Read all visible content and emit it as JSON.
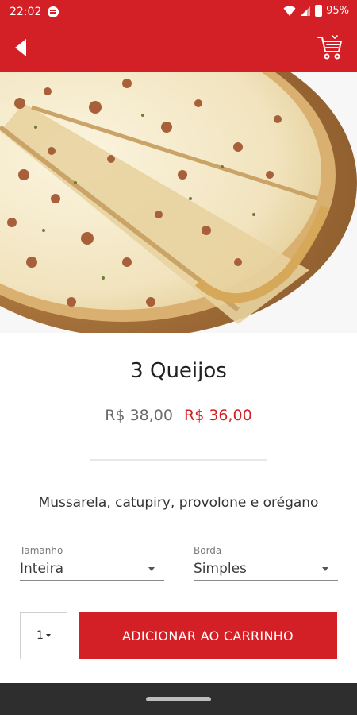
{
  "status_bar": {
    "time": "22:02",
    "battery": "95%",
    "icons": [
      "app-notification-icon",
      "wifi-icon",
      "signal-icon",
      "battery-icon"
    ]
  },
  "app_bar": {
    "background_color": "#d32026",
    "icons": [
      "back-arrow-icon",
      "cart-icon"
    ]
  },
  "product": {
    "image": "pizza-photo",
    "name": "3 Queijos",
    "old_price": "R$ 38,00",
    "price": "R$ 36,00",
    "description": "Mussarela, catupiry, provolone e orégano"
  },
  "options": {
    "size": {
      "label": "Tamanho",
      "value": "Inteira"
    },
    "border": {
      "label": "Borda",
      "value": "Simples"
    }
  },
  "cart_action": {
    "quantity": "1",
    "add_label": "ADICIONAR AO CARRINHO"
  },
  "colors": {
    "accent": "#d32026",
    "nav_bar": "#2e2e2e"
  }
}
